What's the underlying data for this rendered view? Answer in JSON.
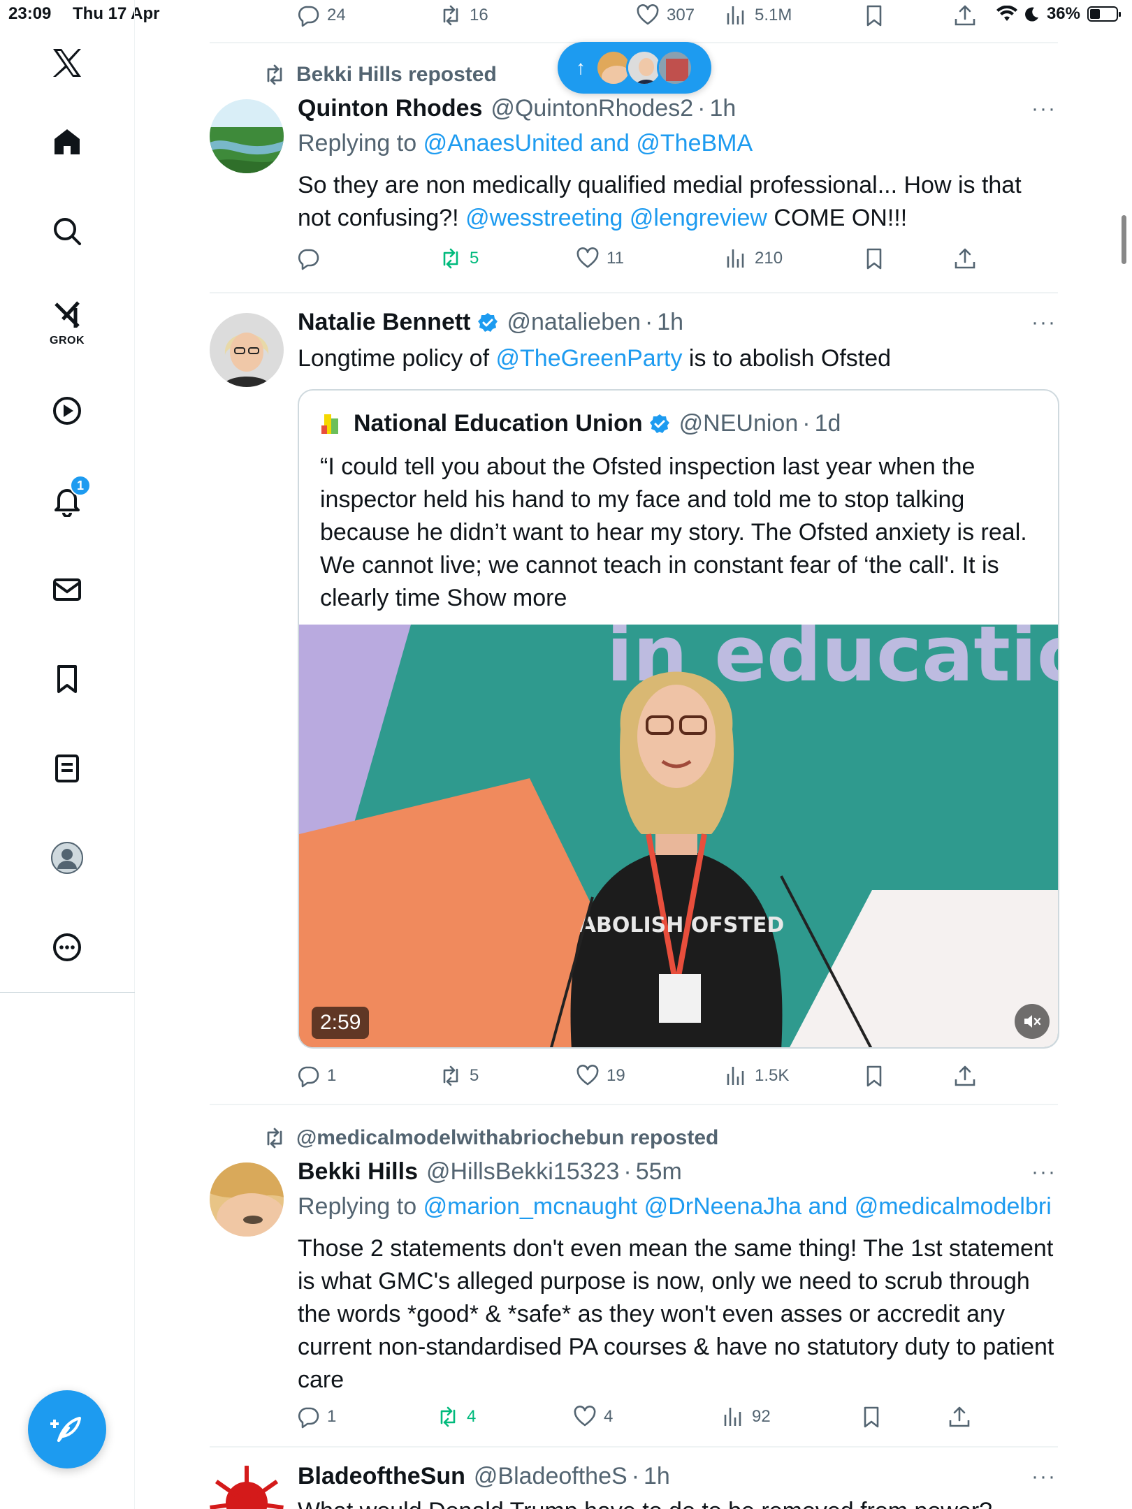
{
  "status_bar": {
    "time": "23:09",
    "date": "Thu 17 Apr",
    "battery": "36%",
    "battery_level": 0.36
  },
  "sidebar": {
    "items": [
      {
        "name": "home",
        "label": "Home"
      },
      {
        "name": "explore",
        "label": "Explore"
      },
      {
        "name": "grok",
        "label": "GROK"
      },
      {
        "name": "video",
        "label": "Video"
      },
      {
        "name": "notifications",
        "label": "Notifications",
        "badge": "1"
      },
      {
        "name": "messages",
        "label": "Messages"
      },
      {
        "name": "bookmarks",
        "label": "Bookmarks"
      },
      {
        "name": "lists",
        "label": "Lists"
      },
      {
        "name": "profile",
        "label": "Profile"
      },
      {
        "name": "more",
        "label": "More"
      }
    ]
  },
  "top_actions": {
    "replies": "24",
    "reposts": "16",
    "likes": "307",
    "views": "5.1M"
  },
  "new_posts_pill": {
    "arrow": "↑"
  },
  "tweets": [
    {
      "reposted_by": "Bekki Hills reposted",
      "name": "Quinton Rhodes",
      "handle": "@QuintonRhodes2",
      "time": "1h",
      "reply_prefix": "Replying to",
      "reply_to": "@AnaesUnited and @TheBMA",
      "text_1": "So they are non medically qualified medial professional... How is that not confusing?! ",
      "mention_1": "@wesstreeting",
      "mention_2": "@lengreview",
      "text_2": " COME ON!!!",
      "replies": "",
      "reposts": "5",
      "likes": "11",
      "views": "210"
    },
    {
      "name": "Natalie Bennett",
      "handle": "@natalieben",
      "time": "1h",
      "text_1": "Longtime policy of ",
      "mention_1": "@TheGreenParty",
      "text_2": " is to abolish Ofsted",
      "quote": {
        "name": "National Education Union",
        "handle": "@NEUnion",
        "time": "1d",
        "text": "“I could tell you about the Ofsted inspection last year when the inspector held his hand to my face and told me to stop talking because he didn’t want to hear my story. The Ofsted anxiety is real. We cannot live; we cannot teach in constant fear of ‘the call'. It is clearly time",
        "show_more": "Show more",
        "video_duration": "2:59",
        "video_text": "in education",
        "shirt_text": "ABOLISH OFSTED"
      },
      "replies": "1",
      "reposts": "5",
      "likes": "19",
      "views": "1.5K"
    },
    {
      "reposted_by": "@medicalmodelwithabriochebun reposted",
      "name": "Bekki Hills",
      "handle": "@HillsBekki15323",
      "time": "55m",
      "reply_prefix": "Replying to",
      "reply_to": "@marion_mcnaught @DrNeenaJha and @medicalmodelbri",
      "text": "Those 2 statements don't even mean the same thing! The 1st statement is what GMC's alleged purpose is now, only we need to scrub through the words *good* & *safe* as they won't even asses or accredit any current non-standardised PA courses & have no statutory duty to patient care",
      "replies": "1",
      "reposts": "4",
      "likes": "4",
      "views": "92"
    },
    {
      "name": "BladeoftheSun",
      "handle": "@BladeoftheS",
      "time": "1h",
      "text": "What would Donald Trump have to do to be removed from power?"
    }
  ],
  "colors": {
    "accent": "#1d9bf0",
    "retweet": "#00ba7c",
    "muted": "#536471",
    "text": "#0f1419"
  },
  "icons": {
    "reply": "speech-bubble-icon",
    "repost": "repost-arrows-icon",
    "like": "heart-icon",
    "views": "bar-chart-icon",
    "bookmark": "bookmark-icon",
    "share": "share-upload-icon",
    "more": "ellipsis-icon",
    "verified": "verified-badge-icon",
    "mute": "muted-speaker-icon",
    "compose": "feather-plus-icon"
  }
}
